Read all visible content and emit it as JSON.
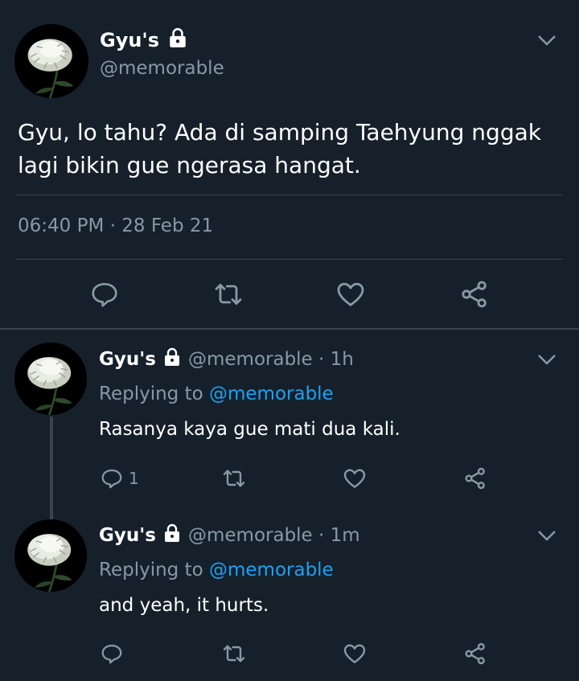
{
  "main_tweet": {
    "display_name": "Gyu's",
    "handle": "@memorable",
    "text_line1": "Gyu, lo tahu? Ada di samping Taehyung nggak",
    "text_line2": "lagi bikin gue ngerasa hangat.",
    "timestamp": "06:40 PM · 28 Feb 21",
    "icons": [
      "lock-icon",
      "chevron-down-icon",
      "reply-icon",
      "retweet-icon",
      "like-icon",
      "share-icon"
    ]
  },
  "replies": [
    {
      "display_name": "Gyu's",
      "handle_time": "@memorable · 1h",
      "replying_prefix": "Replying to",
      "replying_to": "@memorable",
      "text": "Rasanya kaya gue mati dua kali.",
      "reply_count": "1"
    },
    {
      "display_name": "Gyu's",
      "handle_time": "@memorable · 1m",
      "replying_prefix": "Replying to",
      "replying_to": "@memorable",
      "text": "and yeah, it hurts.",
      "reply_count": ""
    }
  ],
  "colors": {
    "background": "#15202b",
    "secondary_text": "#8899a6",
    "link": "#1da1f2",
    "divider": "#38444d"
  }
}
